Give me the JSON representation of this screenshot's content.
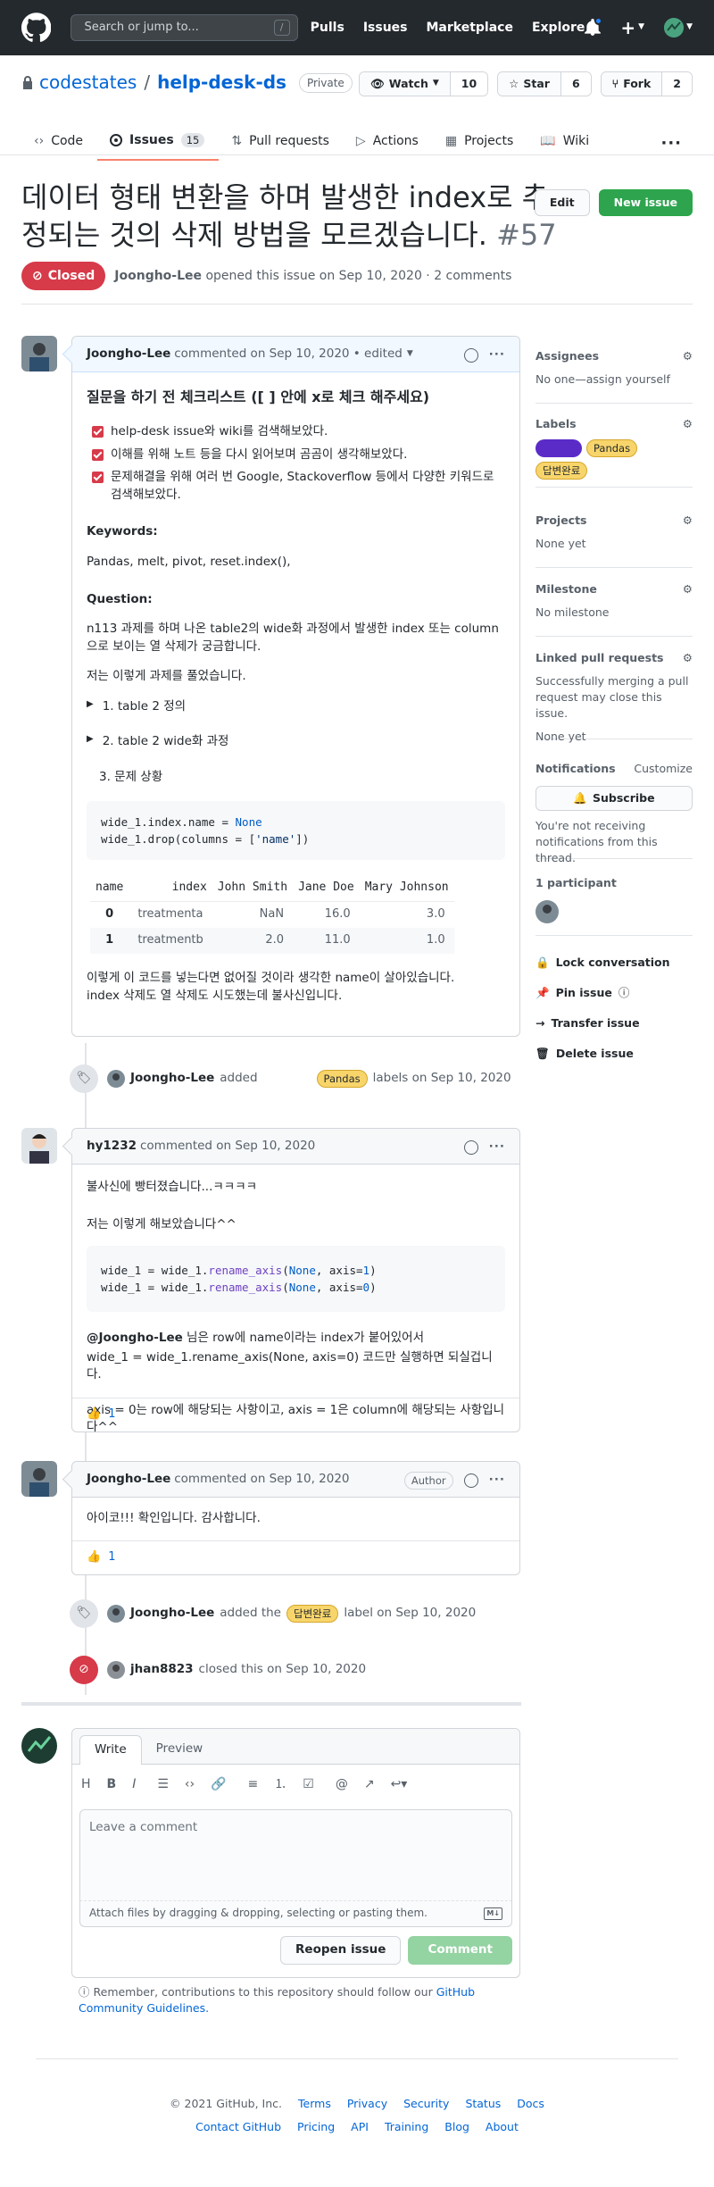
{
  "header": {
    "search_placeholder": "Search or jump to...",
    "search_key": "/",
    "nav": [
      "Pulls",
      "Issues",
      "Marketplace",
      "Explore"
    ]
  },
  "repo": {
    "owner": "codestates",
    "separator": "/",
    "name": "help-desk-ds",
    "visibility": "Private",
    "watch_label": "Watch",
    "watch_count": "10",
    "star_label": "Star",
    "star_count": "6",
    "fork_label": "Fork",
    "fork_count": "2"
  },
  "tabs": [
    {
      "label": "Code"
    },
    {
      "label": "Issues",
      "count": "15"
    },
    {
      "label": "Pull requests"
    },
    {
      "label": "Actions"
    },
    {
      "label": "Projects"
    },
    {
      "label": "Wiki"
    }
  ],
  "issue": {
    "title": "데이터 형태 변환을 하며 발생한 index로 추정되는 것의 삭제 방법을 모르겠습니다.",
    "number": "#57",
    "edit_label": "Edit",
    "new_issue_label": "New issue",
    "state": "Closed",
    "author": "Joongho-Lee",
    "opened_text": "opened this issue on Sep 10, 2020 · 2 comments"
  },
  "first_comment": {
    "author": "Joongho-Lee",
    "meta": "commented on Sep 10, 2020 • edited",
    "heading": "질문을 하기 전 체크리스트 ([ ] 안에 x로 체크 해주세요)",
    "checks": [
      "help-desk issue와 wiki를 검색해보았다.",
      "이해를 위해 노트 등을 다시 읽어보며 곰곰이 생각해보았다.",
      "문제해결을 위해 여러 번 Google, Stackoverflow 등에서 다양한 키워드로 검색해보았다."
    ],
    "keywords_label": "Keywords:",
    "keywords": "Pandas, melt, pivot, reset.index(),",
    "question_label": "Question:",
    "question": "n113 과제를 하며 나온 table2의 wide화 과정에서 발생한 index 또는 column으로 보이는 열 삭제가 궁금합니다.",
    "process": "저는 이렇게 과제를 풀었습니다.",
    "details": [
      "1. table 2 정의",
      "2. table 2 wide화 과정"
    ],
    "problem": "3. 문제 상황",
    "code_lines": [
      "wide_1.index.name = None",
      "wide_1.drop(columns = ['name'])"
    ],
    "table": {
      "columns": [
        "name",
        "index",
        "John Smith",
        "Jane Doe",
        "Mary Johnson"
      ],
      "rows": [
        [
          "0",
          "treatmenta",
          "NaN",
          "16.0",
          "3.0"
        ],
        [
          "1",
          "treatmentb",
          "2.0",
          "11.0",
          "1.0"
        ]
      ]
    },
    "outro1": "이렇게 이 코드를 넣는다면 없어질 것이라 생각한 name이 살아있습니다.",
    "outro2": "index 삭제도 열 삭제도 시도했는데 불사신입니다."
  },
  "event_labels": {
    "actor": "Joongho-Lee",
    "verb": "added",
    "label1": "",
    "label2": "Pandas",
    "tail": "labels on Sep 10, 2020"
  },
  "second_comment": {
    "author": "hy1232",
    "meta": "commented on Sep 10, 2020",
    "line1": "불사신에 빵터졌습니다...ㅋㅋㅋㅋ",
    "line2": "저는 이렇게 해보았습니다^^",
    "code_lines": [
      "wide_1 = wide_1.rename_axis(None, axis=1)",
      "wide_1 = wide_1.rename_axis(None, axis=0)"
    ],
    "mention": "@Joongho-Lee",
    "line3": " 님은 row에 name이라는 index가 붙어있어서",
    "line4": "wide_1 = wide_1.rename_axis(None, axis=0) 코드만 실행하면 되실겁니다.",
    "line5": "axis = 0는 row에 해당되는 사항이고, axis = 1은 column에 해당되는 사항입니다^^",
    "reaction_count": "1"
  },
  "third_comment": {
    "author": "Joongho-Lee",
    "meta": "commented on Sep 10, 2020",
    "badge": "Author",
    "body": "아이코!!! 확인입니다. 감사합니다.",
    "reaction_count": "1"
  },
  "event_label2": {
    "actor": "Joongho-Lee",
    "verb": "added the",
    "label": "답변완료",
    "tail": "label on Sep 10, 2020"
  },
  "event_closed": {
    "actor": "jhan8823",
    "tail": "closed this on Sep 10, 2020"
  },
  "sidebar": {
    "assignees": "Assignees",
    "assignees_value": "No one—assign yourself",
    "labels": "Labels",
    "label_items": [
      "",
      "Pandas",
      "답변완료"
    ],
    "projects": "Projects",
    "projects_value": "None yet",
    "milestone": "Milestone",
    "milestone_value": "No milestone",
    "linked": "Linked pull requests",
    "linked_value": "Successfully merging a pull request may close this issue.",
    "linked_none": "None yet",
    "notifications": "Notifications",
    "customize": "Customize",
    "subscribe": "Subscribe",
    "notify_text": "You're not receiving notifications from this thread.",
    "participants": "1 participant",
    "lock": "Lock conversation",
    "pin": "Pin issue",
    "transfer": "Transfer issue",
    "delete": "Delete issue"
  },
  "new_comment": {
    "write": "Write",
    "preview": "Preview",
    "placeholder": "Leave a comment",
    "attach": "Attach files by dragging & dropping, selecting or pasting them.",
    "reopen": "Reopen issue",
    "comment": "Comment",
    "note": "Remember, contributions to this repository should follow our",
    "note_link": "GitHub Community Guidelines."
  },
  "footer": {
    "copyright": "© 2021 GitHub, Inc.",
    "row1": [
      "Terms",
      "Privacy",
      "Security",
      "Status",
      "Docs"
    ],
    "row2": [
      "Contact GitHub",
      "Pricing",
      "API",
      "Training",
      "Blog",
      "About"
    ]
  },
  "colors": {
    "header_bg": "#24292e",
    "closed_red": "#d73a49",
    "green": "#2ea44f",
    "link": "#0366d6"
  }
}
